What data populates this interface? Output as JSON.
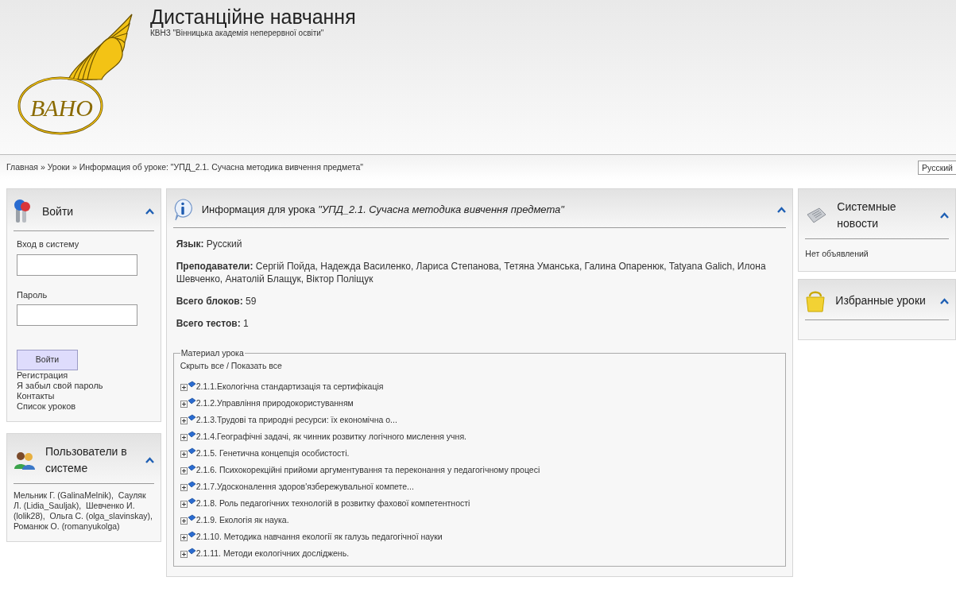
{
  "header": {
    "logo_text": "ВАНО",
    "title": "Дистанційне навчання",
    "subtitle": "КВНЗ \"Вінницька академія неперервної освіти\""
  },
  "breadcrumb": {
    "text": "Главная » Уроки » Информация об уроке: \"УПД_2.1. Сучасна методика вивчення предмета\""
  },
  "language_select": {
    "value": "Русский"
  },
  "login_panel": {
    "title": "Войти",
    "expanded": true,
    "login_label": "Вход в систему",
    "password_label": "Пароль",
    "button": "Войти",
    "links": [
      "Регистрация",
      "Я забыл свой пароль",
      "Контакты",
      "Список уроков"
    ]
  },
  "users_panel": {
    "title": "Пользователи в системе",
    "expanded": true,
    "text": "Мельник Г. (GalinaMelnik),  Сауляк Л. (Lidia_Sauljak),  Шевченко И. (lolik28),  Ольга С. (olga_slavinskay),  Романюк О. (romanyukolga)"
  },
  "lesson_panel": {
    "title": "Информация для урока *\"УПД_2.1. Сучасна методика вивчення предмета\"*",
    "expanded": true,
    "fields": [
      "**Язык:** Русский",
      "**Преподаватели:** Сергій Пойда, Надежда Василенко, Лариса Степанова, Тетяна Уманська, Галина Опаренюк, Tatyana Galich, Илона Шевченко, Анатолій Блащук, Віктор Поліщук",
      "**Всего блоков:** 59",
      "**Всего тестов:** 1"
    ]
  },
  "material": {
    "legend": "Материал урока",
    "toggle": "Скрыть все / Показать все",
    "items": [
      {
        "label": "2.1.1.Екологічна стандартизація та сертифікація",
        "expanded": false
      },
      {
        "label": "2.1.2.Управління природокористуванням",
        "expanded": false
      },
      {
        "label": "2.1.3.Трудові та природні ресурси: їх економічна о...",
        "expanded": false
      },
      {
        "label": "2.1.4.Географічні задачі, як чинник розвитку логічного мислення учня.",
        "expanded": false
      },
      {
        "label": "2.1.5. Генетична концепція особистості.",
        "expanded": false
      },
      {
        "label": "2.1.6. Психокорекційні прийоми аргументування та переконання у педагогічному процесі",
        "expanded": false
      },
      {
        "label": "2.1.7.Удосконалення здоров'язбережувальної компете...",
        "expanded": false
      },
      {
        "label": "2.1.8. Роль педагогічних технологій в розвитку фахової компетентності",
        "expanded": false
      },
      {
        "label": "2.1.9. Екологія як наука.",
        "expanded": false
      },
      {
        "label": "2.1.10. Методика навчання екології як галузь педагогічної науки",
        "expanded": false
      },
      {
        "label": "2.1.11. Методи екологічних досліджень.",
        "expanded": false
      }
    ]
  },
  "news_panel": {
    "title": "Системные новости",
    "expanded": true,
    "text": "Нет объявлений"
  },
  "favorites_panel": {
    "title": "Избранные уроки",
    "expanded": true
  }
}
